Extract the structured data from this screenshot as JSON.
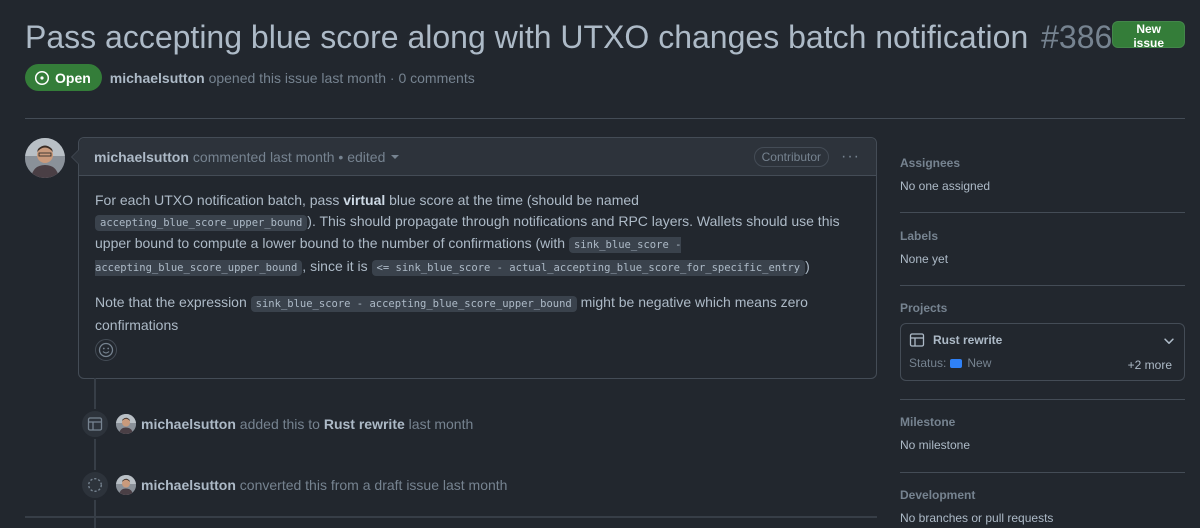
{
  "issue": {
    "title": "Pass accepting blue score along with UTXO changes batch notification",
    "number": "#386",
    "state": "Open",
    "author": "michaelsutton",
    "meta_suffix": "opened this issue last month · 0 comments"
  },
  "header": {
    "new_issue_label": "New issue"
  },
  "comment": {
    "author": "michaelsutton",
    "action": "commented last month",
    "edited": "• edited",
    "role": "Contributor",
    "menu": "···",
    "p1": {
      "t1": "For each UTXO notification batch, pass ",
      "bold": "virtual",
      "t2": " blue score at the time (should be named ",
      "code1": "accepting_blue_score_upper_bound",
      "t3": "). This should propagate through notifications and RPC layers. Wallets should use this upper bound to compute a lower bound to the number of confirmations (with ",
      "code2": "sink_blue_score - accepting_blue_score_upper_bound",
      "t4": ", since it is ",
      "code3": "<= sink_blue_score - actual_accepting_blue_score_for_specific_entry",
      "t5": ")"
    },
    "p2": {
      "t1": "Note that the expression ",
      "code1": "sink_blue_score - accepting_blue_score_upper_bound",
      "t2": " might be negative which means zero confirmations"
    }
  },
  "timeline": [
    {
      "icon": "table-icon",
      "actor": "michaelsutton",
      "text1": "added this to",
      "target": "Rust rewrite",
      "text2": "last month"
    },
    {
      "icon": "draft-issue-icon",
      "actor": "michaelsutton",
      "text1": "converted this from a draft issue last month"
    }
  ],
  "sidebar": {
    "assignees": {
      "title": "Assignees",
      "value": "No one assigned"
    },
    "labels": {
      "title": "Labels",
      "value": "None yet"
    },
    "projects": {
      "title": "Projects",
      "name": "Rust rewrite",
      "status_label": "Status:",
      "status": "New",
      "more": "+2 more"
    },
    "milestone": {
      "title": "Milestone",
      "value": "No milestone"
    },
    "development": {
      "title": "Development",
      "value": "No branches or pull requests"
    }
  },
  "colors": {
    "open_green": "#347d39",
    "background": "#22272e",
    "accent_blue": "#2f81f7"
  }
}
